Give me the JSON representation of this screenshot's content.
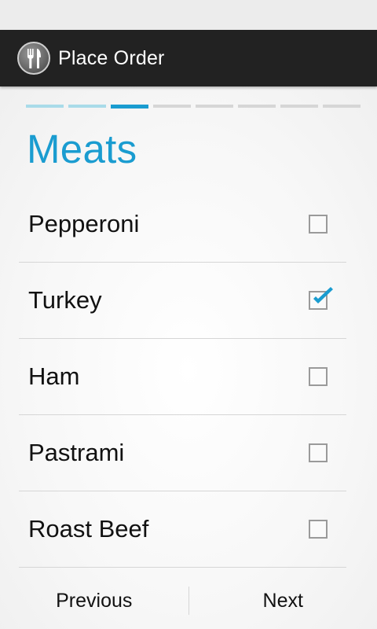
{
  "action_bar": {
    "title": "Place Order",
    "icon": "fork-knife-icon"
  },
  "wizard": {
    "total_steps": 8,
    "current_step": 3
  },
  "page": {
    "title": "Meats"
  },
  "items": [
    {
      "label": "Pepperoni",
      "checked": false
    },
    {
      "label": "Turkey",
      "checked": true
    },
    {
      "label": "Ham",
      "checked": false
    },
    {
      "label": "Pastrami",
      "checked": false
    },
    {
      "label": "Roast Beef",
      "checked": false
    }
  ],
  "footer": {
    "previous_label": "Previous",
    "next_label": "Next"
  },
  "colors": {
    "accent": "#1a9cd0",
    "accent_light": "#a9dbe9",
    "action_bar": "#222222"
  }
}
